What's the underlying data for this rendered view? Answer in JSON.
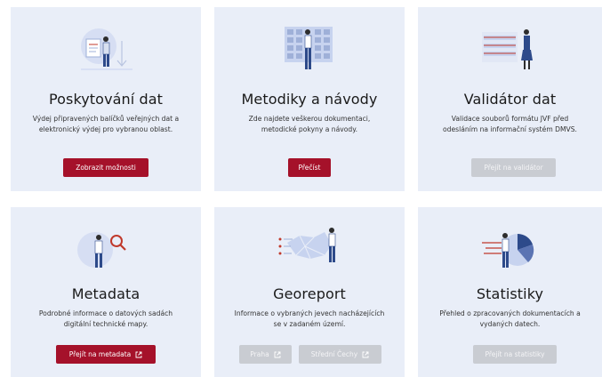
{
  "cards": [
    {
      "title": "Poskytování dat",
      "description": "Výdej připravených balíčků veřejných dat a elektronický výdej pro vybranou oblast.",
      "buttons": [
        {
          "label": "Zobrazit možnosti",
          "state": "primary",
          "external": false
        }
      ],
      "icon": "person-with-documents-illustration"
    },
    {
      "title": "Metodiky a návody",
      "description": "Zde najdete veškerou dokumentaci, metodické pokyny a návody.",
      "buttons": [
        {
          "label": "Přečíst",
          "state": "primary",
          "external": false
        }
      ],
      "icon": "person-with-grid-board-illustration"
    },
    {
      "title": "Validátor dat",
      "description": "Validace souborů formátu JVF před odesláním na informační systém DMVS.",
      "buttons": [
        {
          "label": "Přejít na validátor",
          "state": "disabled",
          "external": false
        }
      ],
      "icon": "person-with-list-board-illustration"
    },
    {
      "title": "Metadata",
      "description": "Podrobné informace o datových sadách digitální technické mapy.",
      "buttons": [
        {
          "label": "Přejít na metadata",
          "state": "primary",
          "external": true
        }
      ],
      "icon": "person-with-magnifier-illustration"
    },
    {
      "title": "Georeport",
      "description": "Informace o vybraných jevech nacházejících se v zadaném území.",
      "buttons": [
        {
          "label": "Praha",
          "state": "disabled",
          "external": true
        },
        {
          "label": "Střední Čechy",
          "state": "disabled",
          "external": true
        }
      ],
      "icon": "person-with-map-illustration"
    },
    {
      "title": "Statistiky",
      "description": "Přehled o zpracovaných dokumentacích a vydaných datech.",
      "buttons": [
        {
          "label": "Přejít na statistiky",
          "state": "disabled",
          "external": false
        }
      ],
      "icon": "person-with-pie-chart-illustration"
    }
  ],
  "colors": {
    "card_bg": "#e9eef8",
    "primary_button": "#a5112a",
    "disabled_button": "#c9ccd2",
    "illustration_blue": "#2d4a8a",
    "illustration_light": "#c7d3ef",
    "illustration_red": "#c0392b"
  }
}
